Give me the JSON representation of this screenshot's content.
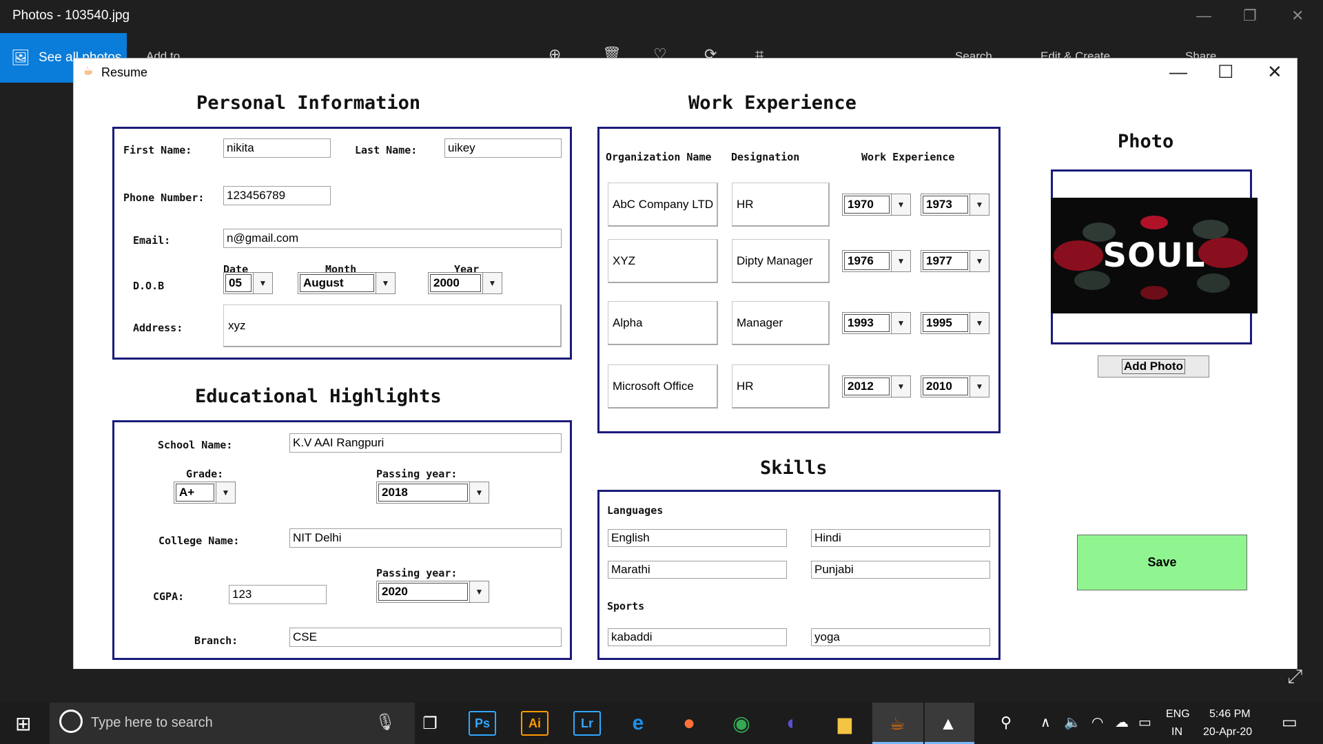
{
  "photos_app": {
    "title": "Photos - 103540.jpg",
    "see_all": "See all photos",
    "add_to": "Add to",
    "search": "Search",
    "edit_create": "Edit & Create",
    "share": "Share"
  },
  "window": {
    "title": "Resume"
  },
  "personal": {
    "heading": "Personal Information",
    "first_name_label": "First Name:",
    "first_name": "nikita",
    "last_name_label": "Last Name:",
    "last_name": "uikey",
    "phone_label": "Phone Number:",
    "phone": "123456789",
    "email_label": "Email:",
    "email": "n@gmail.com",
    "dob_label": "D.O.B",
    "date_label": "Date",
    "month_label": "Month",
    "year_label": "Year",
    "date": "05",
    "month": "August",
    "year": "2000",
    "address_label": "Address:",
    "address": "xyz"
  },
  "education": {
    "heading": "Educational Highlights",
    "school_label": "School Name:",
    "school": "K.V AAI Rangpuri",
    "grade_label": "Grade:",
    "grade": "A+",
    "passing_label_1": "Passing year:",
    "passing_year_1": "2018",
    "college_label": "College Name:",
    "college": "NIT Delhi",
    "cgpa_label": "CGPA:",
    "cgpa": "123",
    "passing_label_2": "Passing year:",
    "passing_year_2": "2020",
    "branch_label": "Branch:",
    "branch": "CSE"
  },
  "work": {
    "heading": "Work Experience",
    "col_org": "Organization Name",
    "col_designation": "Designation",
    "col_experience": "Work Experience",
    "rows": [
      {
        "org": "AbC Company LTD",
        "designation": "HR",
        "from": "1970",
        "to": "1973"
      },
      {
        "org": "XYZ",
        "designation": "Dipty Manager",
        "from": "1976",
        "to": "1977"
      },
      {
        "org": "Alpha",
        "designation": "Manager",
        "from": "1993",
        "to": "1995"
      },
      {
        "org": "Microsoft Office",
        "designation": "HR",
        "from": "2012",
        "to": "2010"
      }
    ]
  },
  "skills": {
    "heading": "Skills",
    "languages_label": "Languages",
    "languages": [
      "English",
      "Hindi",
      "Marathi",
      "Punjabi"
    ],
    "sports_label": "Sports",
    "sports": [
      "kabaddi",
      "yoga"
    ]
  },
  "photo": {
    "heading": "Photo",
    "image_text": "SOUL",
    "add_button": "Add Photo"
  },
  "save_button": "Save",
  "taskbar": {
    "search_placeholder": "Type here to search",
    "language_top": "ENG",
    "language_bottom": "IN",
    "time": "5:46 PM",
    "date": "20-Apr-20",
    "app_labels": [
      "Ps",
      "Ai",
      "Lr"
    ]
  },
  "colors": {
    "panel_border": "#1a1a7a",
    "save_bg": "#90f590",
    "photos_accent": "#0a7cd9"
  }
}
